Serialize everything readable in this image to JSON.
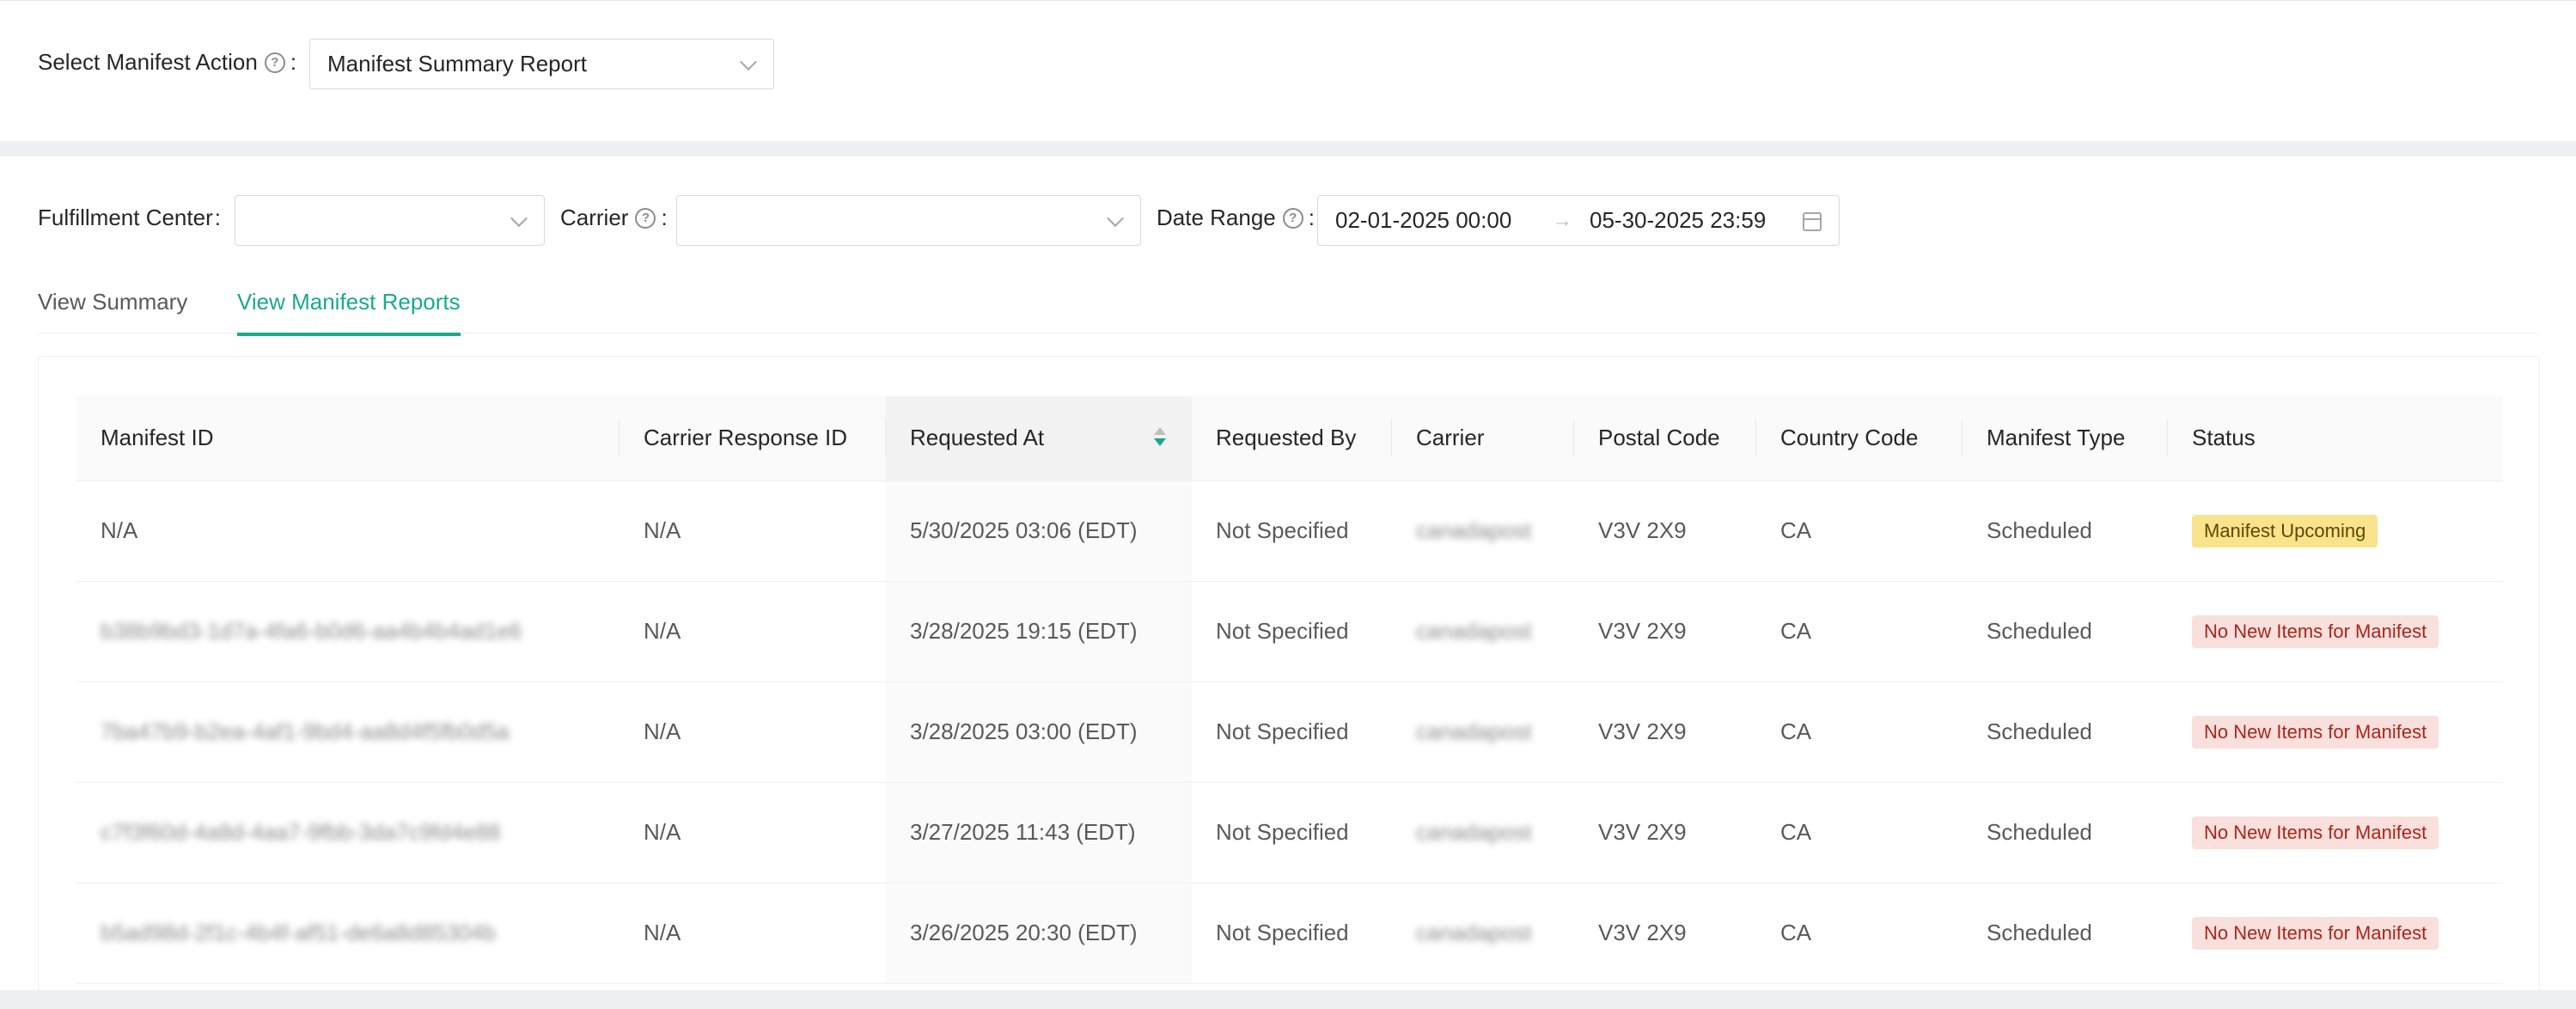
{
  "manifest_action": {
    "label": "Select Manifest Action",
    "value": "Manifest Summary Report"
  },
  "filters": {
    "fulfillment_center_label": "Fulfillment Center",
    "fulfillment_center_value": "",
    "carrier_label": "Carrier",
    "carrier_value": "",
    "date_range_label": "Date Range",
    "date_from": "02-01-2025 00:00",
    "date_to": "05-30-2025 23:59"
  },
  "tabs": [
    {
      "label": "View Summary",
      "active": false
    },
    {
      "label": "View Manifest Reports",
      "active": true
    }
  ],
  "table": {
    "columns": [
      "Manifest ID",
      "Carrier Response ID",
      "Requested At",
      "Requested By",
      "Carrier",
      "Postal Code",
      "Country Code",
      "Manifest Type",
      "Status"
    ],
    "rows": [
      {
        "manifest_id": "N/A",
        "carrier_response_id": "N/A",
        "requested_at": "5/30/2025 03:06 (EDT)",
        "requested_by": "Not Specified",
        "carrier": "canadapost",
        "postal_code": "V3V 2X9",
        "country_code": "CA",
        "manifest_type": "Scheduled",
        "status": "Manifest Upcoming",
        "status_kind": "upcoming"
      },
      {
        "manifest_id": "b38b9bd3-1d7a-4fa6-b0d6-aa4b4b4ad1e6",
        "carrier_response_id": "N/A",
        "requested_at": "3/28/2025 19:15 (EDT)",
        "requested_by": "Not Specified",
        "carrier": "canadapost",
        "postal_code": "V3V 2X9",
        "country_code": "CA",
        "manifest_type": "Scheduled",
        "status": "No New Items for Manifest",
        "status_kind": "none"
      },
      {
        "manifest_id": "7ba47b9-b2ea-4af1-9bd4-aa8d4f5fb0d5a",
        "carrier_response_id": "N/A",
        "requested_at": "3/28/2025 03:00 (EDT)",
        "requested_by": "Not Specified",
        "carrier": "canadapost",
        "postal_code": "V3V 2X9",
        "country_code": "CA",
        "manifest_type": "Scheduled",
        "status": "No New Items for Manifest",
        "status_kind": "none"
      },
      {
        "manifest_id": "c7f3f60d-4a8d-4aa7-9fbb-3da7c9fd4e88",
        "carrier_response_id": "N/A",
        "requested_at": "3/27/2025 11:43 (EDT)",
        "requested_by": "Not Specified",
        "carrier": "canadapost",
        "postal_code": "V3V 2X9",
        "country_code": "CA",
        "manifest_type": "Scheduled",
        "status": "No New Items for Manifest",
        "status_kind": "none"
      },
      {
        "manifest_id": "b5ad98d-2f1c-4b4f-af51-de6a8d85304b",
        "carrier_response_id": "N/A",
        "requested_at": "3/26/2025 20:30 (EDT)",
        "requested_by": "Not Specified",
        "carrier": "canadapost",
        "postal_code": "V3V 2X9",
        "country_code": "CA",
        "manifest_type": "Scheduled",
        "status": "No New Items for Manifest",
        "status_kind": "none"
      }
    ]
  },
  "colors": {
    "accent": "#1aa98c",
    "badge_upcoming_bg": "#f9e48d",
    "badge_none_bg": "#f9e0dc"
  }
}
